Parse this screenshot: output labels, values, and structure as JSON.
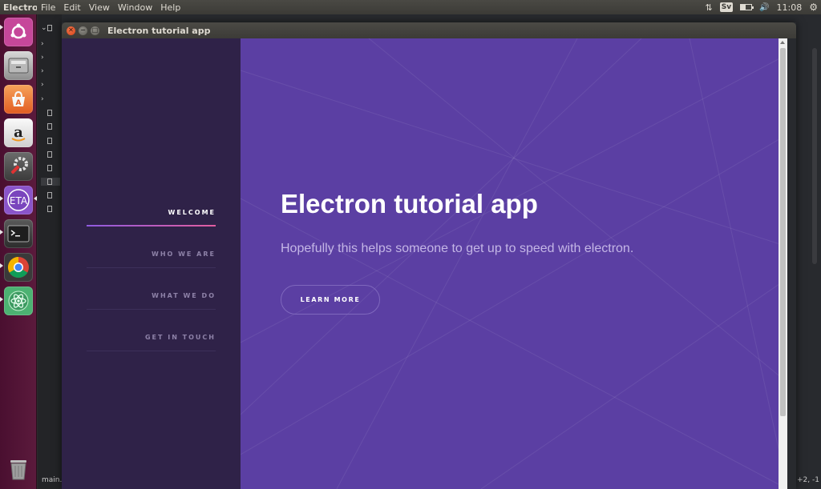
{
  "topbar": {
    "app_name": "Electron",
    "menu": [
      "File",
      "Edit",
      "View",
      "Window",
      "Help"
    ],
    "keyboard_layout": "Sv",
    "volume_glyph": "🔊",
    "clock": "11:08",
    "battery_level": 0.45
  },
  "launcher": {
    "items": [
      {
        "name": "ubuntu-dash-icon"
      },
      {
        "name": "files-icon"
      },
      {
        "name": "software-center-icon"
      },
      {
        "name": "amazon-icon"
      },
      {
        "name": "system-settings-icon"
      },
      {
        "name": "eta-icon",
        "label": "ETA"
      },
      {
        "name": "terminal-icon"
      },
      {
        "name": "chrome-icon"
      },
      {
        "name": "atom-icon"
      },
      {
        "name": "trash-icon"
      }
    ]
  },
  "editor": {
    "status_file": "main.js",
    "status_right": "+2, -1"
  },
  "window": {
    "title": "Electron tutorial app",
    "nav": [
      {
        "label": "WELCOME",
        "active": true
      },
      {
        "label": "WHO WE ARE",
        "active": false
      },
      {
        "label": "WHAT WE DO",
        "active": false
      },
      {
        "label": "GET IN TOUCH",
        "active": false
      }
    ],
    "hero": {
      "title": "Electron tutorial app",
      "subtitle": "Hopefully this helps someone to get up to speed with electron.",
      "button": "LEARN MORE"
    }
  },
  "colors": {
    "sidebar_bg": "#2f2248",
    "main_bg": "#5b3fa3",
    "launcher_bg": "#5b1a3c",
    "panel_bg": "#3c3b37"
  }
}
